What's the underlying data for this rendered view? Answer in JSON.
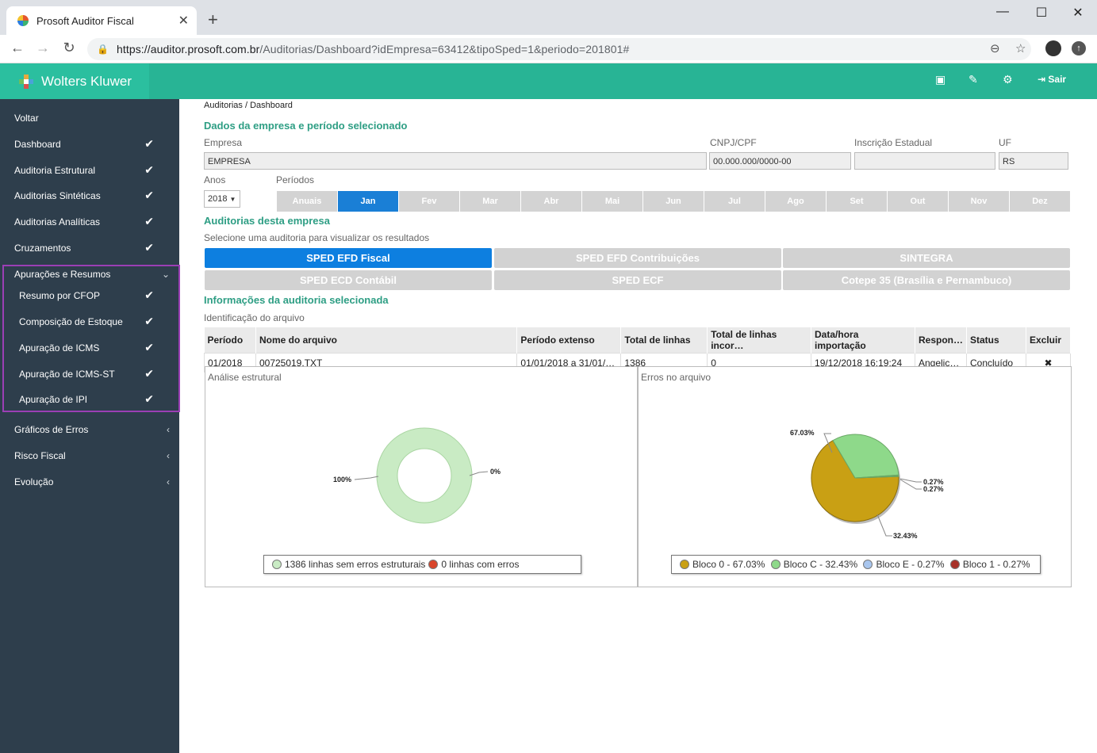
{
  "browser": {
    "tab_title": "Prosoft Auditor Fiscal",
    "url_host": "https://auditor.prosoft.com.br",
    "url_path": "/Auditorias/Dashboard?idEmpresa=63412&tipoSped=1&periodo=201801#"
  },
  "header": {
    "brand": "Wolters Kluwer",
    "logout_label": "Sair"
  },
  "sidebar": {
    "items": [
      {
        "label": "Voltar"
      },
      {
        "label": "Dashboard",
        "check": "✔"
      },
      {
        "label": "Auditoria Estrutural",
        "check": "✔"
      },
      {
        "label": "Auditorias Sintéticas",
        "check": "✔"
      },
      {
        "label": "Auditorias Analíticas",
        "check": "✔"
      },
      {
        "label": "Cruzamentos",
        "check": "✔"
      },
      {
        "label": "Apurações e Resumos",
        "chevron": "⌄"
      }
    ],
    "sub_items": [
      {
        "label": "Resumo por CFOP",
        "check": "✔"
      },
      {
        "label": "Composição de Estoque",
        "check": "✔"
      },
      {
        "label": "Apuração de ICMS",
        "check": "✔"
      },
      {
        "label": "Apuração de ICMS-ST",
        "check": "✔"
      },
      {
        "label": "Apuração de IPI",
        "check": "✔"
      }
    ],
    "bottom_items": [
      {
        "label": "Gráficos de Erros",
        "chevron": "‹"
      },
      {
        "label": "Risco Fiscal",
        "chevron": "‹"
      },
      {
        "label": "Evolução",
        "chevron": "‹"
      }
    ]
  },
  "breadcrumb": {
    "root": "Auditorias",
    "sep": " / ",
    "current": "Dashboard"
  },
  "company": {
    "section_title": "Dados da empresa e período selecionado",
    "empresa_label": "Empresa",
    "empresa_value": "EMPRESA",
    "cnpj_label": "CNPJ/CPF",
    "cnpj_value": "00.000.000/0000-00",
    "ie_label": "Inscrição Estadual",
    "ie_value": "",
    "uf_label": "UF",
    "uf_value": "RS",
    "anos_label": "Anos",
    "ano_value": "2018",
    "periodos_label": "Períodos",
    "periods": [
      "Anuais",
      "Jan",
      "Fev",
      "Mar",
      "Abr",
      "Mai",
      "Jun",
      "Jul",
      "Ago",
      "Set",
      "Out",
      "Nov",
      "Dez"
    ],
    "active_period": "Jan"
  },
  "audits": {
    "section_title": "Auditorias desta empresa",
    "hint": "Selecione uma auditoria para visualizar os resultados",
    "buttons": [
      "SPED EFD Fiscal",
      "SPED EFD Contribuições",
      "SINTEGRA",
      "SPED ECD Contábil",
      "SPED ECF",
      "Cotepe 35 (Brasília e Pernambuco)"
    ],
    "active": "SPED EFD Fiscal"
  },
  "info": {
    "section_title": "Informações da auditoria selecionada",
    "subtitle": "Identificação do arquivo",
    "columns": [
      "Período",
      "Nome do arquivo",
      "Período extenso",
      "Total de linhas",
      "Total de linhas incor…",
      "Data/hora importação",
      "Respon…",
      "Status",
      "Excluir"
    ],
    "row": [
      "01/2018",
      "00725019.TXT",
      "01/01/2018 a 31/01/…",
      "1386",
      "0",
      "19/12/2018 16:19:24",
      "Angelic…",
      "Concluído",
      "✖"
    ]
  },
  "charts": {
    "structural": {
      "title": "Análise estrutural",
      "label_a": "100%",
      "label_b": "0%",
      "legend": [
        "1386 linhas sem erros estruturais",
        "0 linhas com erros"
      ],
      "colors": [
        "#c9ebc4",
        "#d9452b"
      ]
    },
    "errors": {
      "title": "Erros no arquivo",
      "labels": [
        "67.03%",
        "32.43%",
        "0.27%",
        "0.27%"
      ],
      "legend": [
        "Bloco 0 - 67.03%",
        "Bloco C - 32.43%",
        "Bloco E - 0.27%",
        "Bloco 1 - 0.27%"
      ],
      "colors": [
        "#c9a014",
        "#8ed98a",
        "#a9c6ee",
        "#a8322a"
      ]
    }
  },
  "chart_data": [
    {
      "type": "pie",
      "title": "Análise estrutural",
      "categories": [
        "1386 linhas sem erros estruturais",
        "0 linhas com erros"
      ],
      "values": [
        100,
        0
      ]
    },
    {
      "type": "pie",
      "title": "Erros no arquivo",
      "categories": [
        "Bloco 0",
        "Bloco C",
        "Bloco E",
        "Bloco 1"
      ],
      "values": [
        67.03,
        32.43,
        0.27,
        0.27
      ]
    }
  ]
}
